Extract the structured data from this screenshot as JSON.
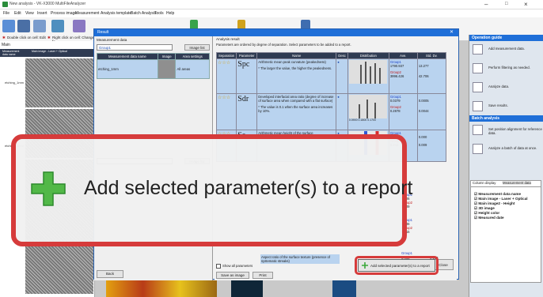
{
  "window": {
    "title": "New analysis - VK-X3000 MultiFileAnalyzer",
    "controls": [
      "–",
      "□",
      "×"
    ]
  },
  "menu": [
    "File",
    "Edit",
    "View",
    "Insert",
    "Process image",
    "Measurement",
    "Analysis template",
    "Batch Analysis",
    "Tools",
    "Help"
  ],
  "toolbar": {
    "labels": [
      "Add",
      "Save",
      "Output data",
      "Process image",
      "3D display",
      "Meas"
    ]
  },
  "hints": {
    "left": "Double click on cell: Edit",
    "right": "Right click on cell: Change fo"
  },
  "main_panel": {
    "title": "Main",
    "rows": [
      "etching_1mm",
      "etching_1mm"
    ],
    "header_cols": [
      "Measurement data name",
      "Main image - Laser + Optical"
    ]
  },
  "measurement_panel": {
    "title": "Measurement data",
    "image_list_label": "Image list",
    "columns": [
      "Measurement data name",
      "Image",
      "Area settings"
    ],
    "rows": [
      {
        "name": "etching_1mm",
        "area": "All areas"
      }
    ],
    "group_label": "Group1",
    "group_image_list": "Image list",
    "back_label": "Back"
  },
  "dialog": {
    "title": "Result",
    "analysis_result": "Analysis result",
    "instructions": "Parameters are ordered by degree of separation. Select parameters to be added to a report.",
    "columns": [
      "Separation",
      "Parameter",
      "Name",
      "Desc",
      "Distribution",
      "Ave.",
      "Std. Dv."
    ],
    "rows": [
      {
        "symbol": "Spc",
        "stars": "☆☆☆",
        "name": "Arithmetic mean peak curvature (peakedness)",
        "note": "* The larger the value, the higher the peakedness.",
        "g1": "Group1",
        "v1": "1790.937",
        "g2": "Group2",
        "v2": "3996.426",
        "s1": "13.277",
        "s2": "42.706"
      },
      {
        "symbol": "Sdr",
        "stars": "☆☆☆",
        "name": "Developed interfacial area ratio (degree of increase of surface area when compared with a flat surface)",
        "note": "* The value is 0.1 when the surface area increases by 10%.",
        "g1": "Group1",
        "v1": "0.0379",
        "g2": "Group2",
        "v2": "0.2878",
        "s1": "0.0005",
        "s2": "0.0044",
        "axis": [
          "0.0900",
          "0.1800",
          "0.1700"
        ]
      },
      {
        "symbol": "Sa",
        "stars": "☆☆☆",
        "name": "Arithmetic mean height of the surface",
        "note": "",
        "g1": "Group1",
        "v1": "0.043",
        "g2": "Group2",
        "v2": "0.244",
        "s1": "0.000",
        "s2": "0.009"
      },
      {
        "symbol": "",
        "stars": "",
        "name": "",
        "note": "",
        "g1": "Group1",
        "v1": "",
        "g2": "Group2",
        "v2": "",
        "s1": "0.006",
        "s2": "0.009"
      },
      {
        "symbol": "",
        "stars": "",
        "name": "",
        "note": "",
        "g1": "Group1",
        "v1": "",
        "g2": "Group2",
        "v2": "",
        "s1": "0.246",
        "s2": "0.315"
      },
      {
        "symbol": "",
        "stars": "",
        "name": "Aspect ratio of the surface texture (presence of systematic streaks)",
        "note": "",
        "g1": "Group1",
        "v1": "0.463",
        "g2": "",
        "v2": "",
        "s1": "0.132",
        "s2": ""
      }
    ],
    "show_all_params": "Show all parameters",
    "save_as_image": "Save as image",
    "print": "Print",
    "add_button": "Add selected parameter(s) to a report",
    "close": "Close"
  },
  "callout": {
    "text": "Add selected parameter(s) to a report"
  },
  "operation_guide": {
    "title": "Operation guide",
    "items": [
      "Add measurement data.",
      "Perform filtering as needed.",
      "Analyze data.",
      "Save results."
    ],
    "batch_title": "Batch analysis",
    "batch_items": [
      "Set position alignment for reference data.",
      "Analyze a batch of data at once."
    ]
  },
  "column_display": {
    "tabs": [
      "Column display",
      "Measurement data"
    ],
    "items": [
      "Measurement data name",
      "Main image - Laser + Optical",
      "Main image2 - Height",
      "3D image",
      "Height color",
      "Measured date"
    ]
  },
  "colors": {
    "accent": "#1f6fd8",
    "highlight": "#d63b3b",
    "table_row": "#b9d3ef",
    "header": "#2f3b52"
  }
}
